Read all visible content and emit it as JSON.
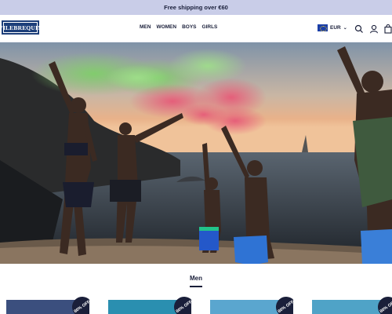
{
  "banner": {
    "text": "Free shipping over €60"
  },
  "header": {
    "logo_text": "VILEBREQUIN",
    "nav": [
      "MEN",
      "WOMEN",
      "BOYS",
      "GIRLS"
    ],
    "currency": "EUR",
    "icons": [
      "search-icon",
      "account-icon",
      "bag-icon"
    ]
  },
  "section": {
    "title": "Men"
  },
  "products": [
    {
      "badge": "80% OFF",
      "color": "#3b4f7e"
    },
    {
      "badge": "80% OFF",
      "color": "#2a8fb0"
    },
    {
      "badge": "80% OFF",
      "color": "#5aa6cf"
    },
    {
      "badge": "80% OFF",
      "color": "#4fa3c7"
    }
  ],
  "colors": {
    "banner": "#c9cde8",
    "navy": "#1a1f3a",
    "logo": "#1d3f7a"
  }
}
